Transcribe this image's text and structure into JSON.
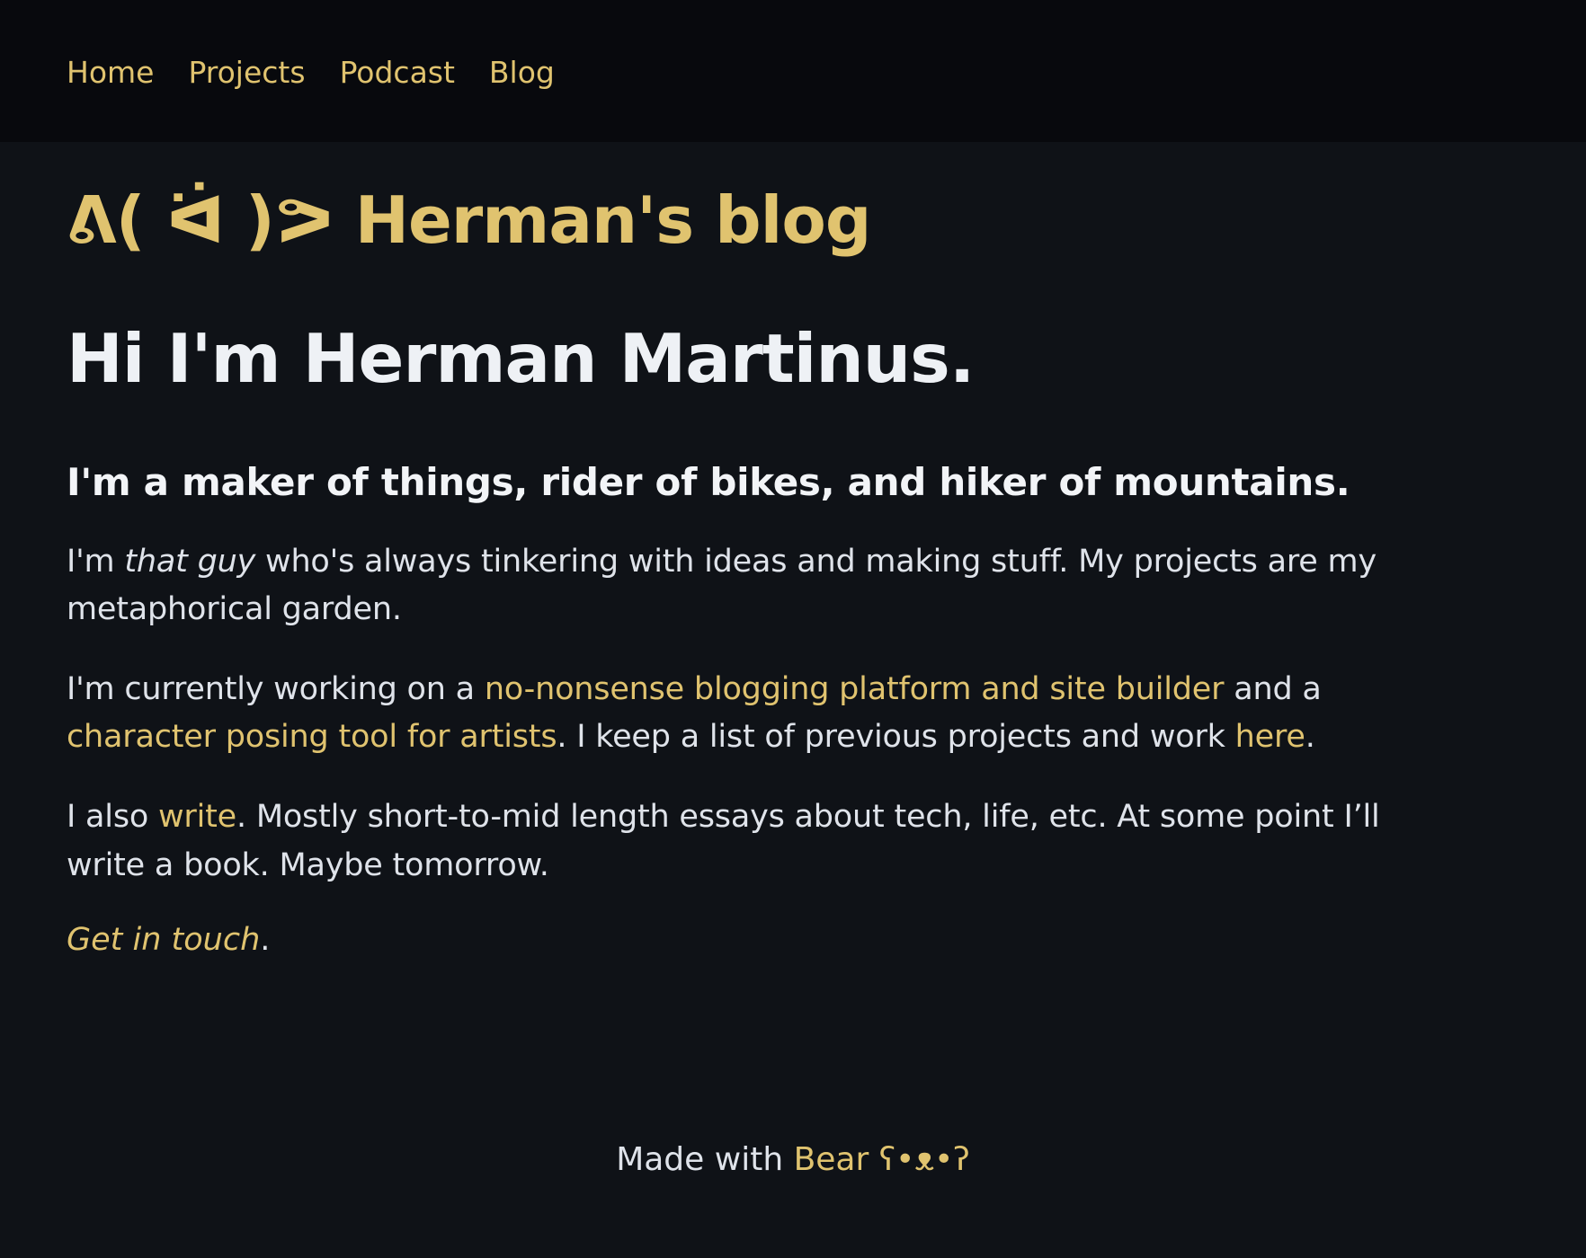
{
  "nav": {
    "items": [
      {
        "label": "Home"
      },
      {
        "label": "Projects"
      },
      {
        "label": "Podcast"
      },
      {
        "label": "Blog"
      }
    ]
  },
  "site": {
    "title": "ᕕ( ᐛ )ᕗ Herman's blog"
  },
  "hero": {
    "title": "Hi I'm Herman Martinus.",
    "subtitle": "I'm a maker of things, rider of bikes, and hiker of mountains."
  },
  "paragraph1": {
    "prefix": "I'm ",
    "emphasis": "that guy",
    "suffix": " who's always tinkering with ideas and making stuff. My projects are my metaphorical garden."
  },
  "paragraph2": {
    "prefix": "I'm currently working on a ",
    "link1": "no-nonsense blogging platform and site builder",
    "middle1": " and a ",
    "link2": "character posing tool for artists",
    "middle2": ". I keep a list of previous projects and work ",
    "link3": "here",
    "suffix": "."
  },
  "paragraph3": {
    "prefix": "I also ",
    "link": "write",
    "suffix": ". Mostly short-to-mid length essays about tech, life, etc. At some point I’ll write a book. Maybe tomorrow."
  },
  "contact": {
    "link": "Get in touch",
    "suffix": "."
  },
  "footer": {
    "prefix": "Made with ",
    "link": "Bear ʕ•ᴥ•ʔ"
  },
  "colors": {
    "background": "#0f1217",
    "header_background": "#08090d",
    "text": "#dfe3ea",
    "link": "#e0c36f"
  }
}
